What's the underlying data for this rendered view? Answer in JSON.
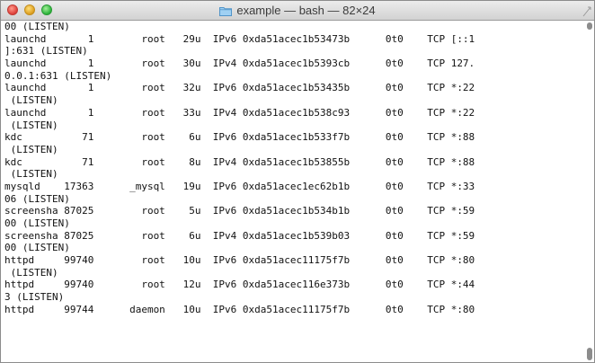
{
  "window": {
    "title": "example — bash — 82×24",
    "title_icon": "folder-icon",
    "controls": [
      "close",
      "minimize",
      "zoom"
    ]
  },
  "terminal": {
    "lines": [
      "00 (LISTEN)",
      "launchd       1        root   29u  IPv6 0xda51acec1b53473b      0t0    TCP [::1",
      "]:631 (LISTEN)",
      "launchd       1        root   30u  IPv4 0xda51acec1b5393cb      0t0    TCP 127.",
      "0.0.1:631 (LISTEN)",
      "launchd       1        root   32u  IPv6 0xda51acec1b53435b      0t0    TCP *:22",
      " (LISTEN)",
      "launchd       1        root   33u  IPv4 0xda51acec1b538c93      0t0    TCP *:22",
      " (LISTEN)",
      "kdc          71        root    6u  IPv6 0xda51acec1b533f7b      0t0    TCP *:88",
      " (LISTEN)",
      "kdc          71        root    8u  IPv4 0xda51acec1b53855b      0t0    TCP *:88",
      " (LISTEN)",
      "mysqld    17363      _mysql   19u  IPv6 0xda51acec1ec62b1b      0t0    TCP *:33",
      "06 (LISTEN)",
      "screensha 87025        root    5u  IPv6 0xda51acec1b534b1b      0t0    TCP *:59",
      "00 (LISTEN)",
      "screensha 87025        root    6u  IPv4 0xda51acec1b539b03      0t0    TCP *:59",
      "00 (LISTEN)",
      "httpd     99740        root   10u  IPv6 0xda51acec11175f7b      0t0    TCP *:80",
      " (LISTEN)",
      "httpd     99740        root   12u  IPv6 0xda51acec116e373b      0t0    TCP *:44",
      "3 (LISTEN)",
      "httpd     99744      daemon   10u  IPv6 0xda51acec11175f7b      0t0    TCP *:80"
    ]
  }
}
